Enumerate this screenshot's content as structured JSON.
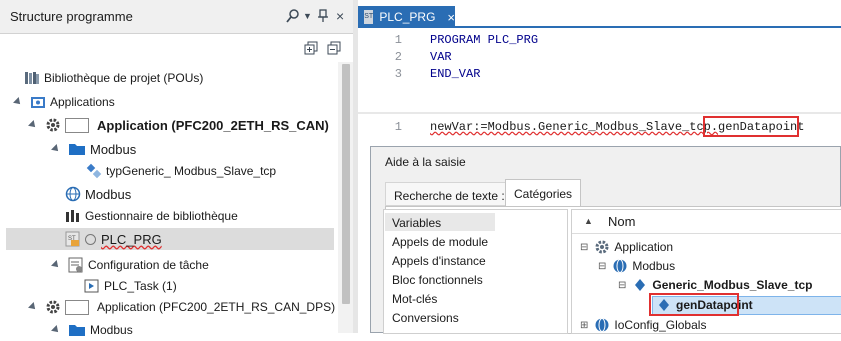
{
  "left_panel": {
    "title": "Structure programme",
    "tree": [
      {
        "label": "Bibliothèque de projet (POUs)"
      },
      {
        "label": "Applications"
      },
      {
        "label": "Application (PFC200_2ETH_RS_CAN)"
      },
      {
        "label": "Modbus"
      },
      {
        "label": "typGeneric_ Modbus_Slave_tcp"
      },
      {
        "label": "Modbus"
      },
      {
        "label": "Gestionnaire de bibliothèque"
      },
      {
        "label": "PLC_PRG"
      },
      {
        "label": "Configuration de tâche"
      },
      {
        "label": "PLC_Task (1)"
      },
      {
        "label": "Application (PFC200_2ETH_RS_CAN_DPS)"
      },
      {
        "label": "Modbus"
      }
    ]
  },
  "editor": {
    "tab_label": "PLC_PRG",
    "tab_badge": "ST",
    "decl_lines": [
      {
        "num": "1",
        "text": "PROGRAM PLC_PRG"
      },
      {
        "num": "2",
        "text": "VAR"
      },
      {
        "num": "3",
        "text": "END_VAR"
      }
    ],
    "body_line": {
      "num": "1",
      "prefix": "newVar:=Modbus.Generic_Modbus_Slave_tcp.",
      "highlight": "genDatapoint"
    }
  },
  "popup": {
    "title": "Aide à la saisie",
    "tab_search": "Recherche de texte :",
    "tab_categories": "Catégories",
    "categories": [
      "Variables",
      "Appels de module",
      "Appels d'instance",
      "Bloc fonctionnels",
      "Mot-clés",
      "Conversions"
    ],
    "column_header": "Nom",
    "results": [
      {
        "label": "Application"
      },
      {
        "label": "Modbus"
      },
      {
        "label": "Generic_Modbus_Slave_tcp"
      },
      {
        "label": "genDatapoint"
      },
      {
        "label": "IoConfig_Globals"
      }
    ]
  },
  "colors": {
    "accent": "#2a6db4",
    "highlight_border": "#e03030",
    "selection": "#cde3f7"
  }
}
